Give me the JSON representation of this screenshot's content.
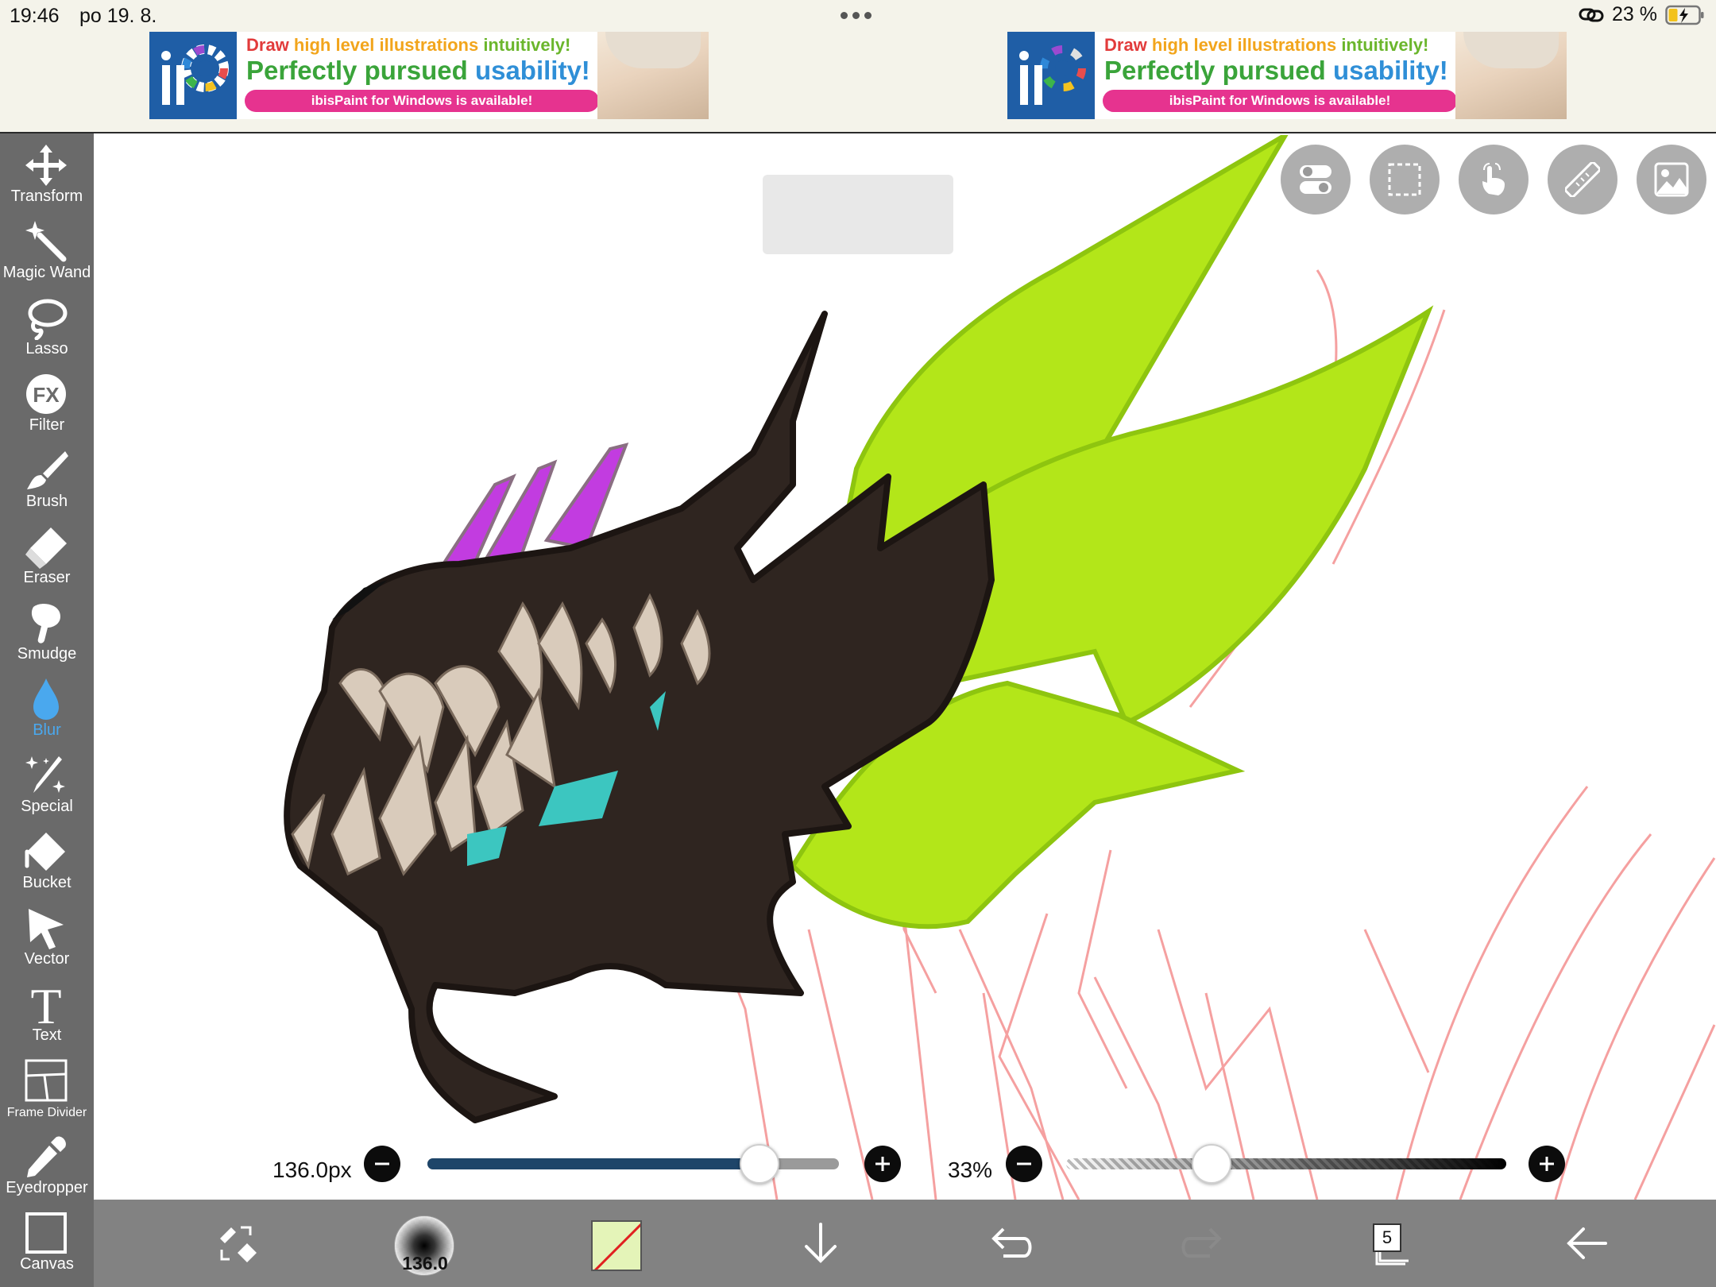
{
  "status": {
    "time": "19:46",
    "date": "po 19. 8.",
    "battery": "23 %"
  },
  "ad": {
    "line1_a": "Draw ",
    "line1_b": "high level illustrations ",
    "line1_c": "intuitively!",
    "line2_a": "Perfectly pursued ",
    "line2_b": "usability!",
    "pill": "ibisPaint for Windows is available!"
  },
  "tools": [
    {
      "label": "Transform",
      "icon": "move-arrows-icon"
    },
    {
      "label": "Magic Wand",
      "icon": "magic-wand-icon"
    },
    {
      "label": "Lasso",
      "icon": "lasso-icon"
    },
    {
      "label": "Filter",
      "icon": "fx-icon"
    },
    {
      "label": "Brush",
      "icon": "brush-icon"
    },
    {
      "label": "Eraser",
      "icon": "eraser-icon"
    },
    {
      "label": "Smudge",
      "icon": "smudge-icon"
    },
    {
      "label": "Blur",
      "icon": "blur-drop-icon",
      "active": true
    },
    {
      "label": "Special",
      "icon": "special-sparkle-icon"
    },
    {
      "label": "Bucket",
      "icon": "bucket-icon"
    },
    {
      "label": "Vector",
      "icon": "vector-cursor-icon"
    },
    {
      "label": "Text",
      "icon": "text-icon"
    },
    {
      "label": "Frame Divider",
      "icon": "frame-divider-icon"
    },
    {
      "label": "Eyedropper",
      "icon": "eyedropper-icon"
    },
    {
      "label": "Canvas",
      "icon": "canvas-icon"
    }
  ],
  "controls": {
    "size_label": "136.0px",
    "size_fraction": 0.807,
    "opacity_label": "33%",
    "opacity_fraction": 0.33,
    "brush_size_preview": "136.0",
    "layer_count": "5"
  },
  "colors": {
    "toolbar": "#6a6a6a",
    "active_tool": "#4aa8ee",
    "size_fill": "#1e4569",
    "dragon_body": "#2f2520",
    "wings": "#b3e619",
    "horns": "#c23ce0",
    "sketch_lines": "#f5a0a0"
  }
}
